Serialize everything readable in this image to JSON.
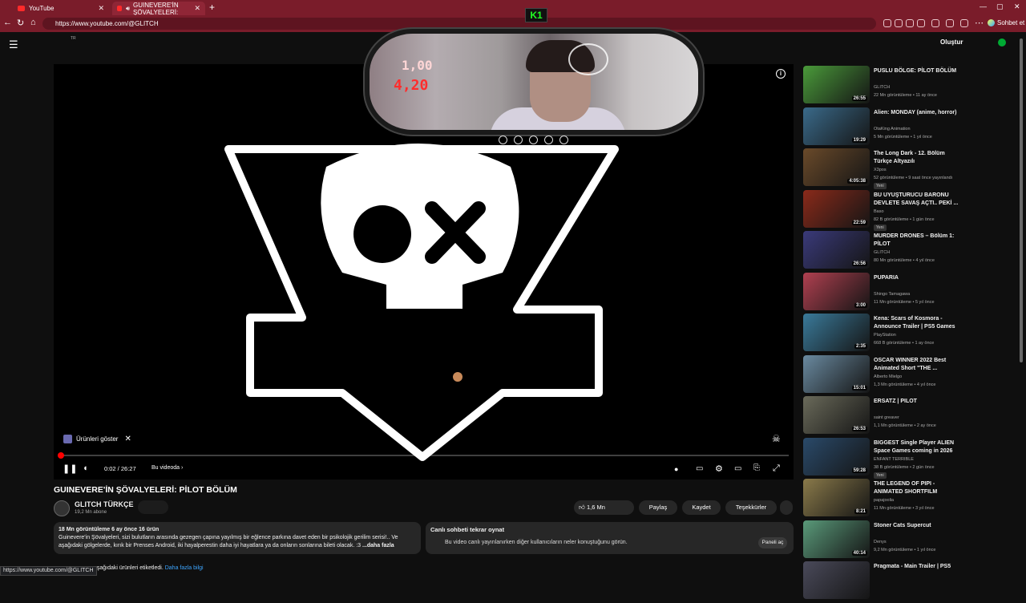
{
  "browser": {
    "tabs": [
      {
        "label": "YouTube"
      },
      {
        "label": "GUINEVERE'İN ŞÖVALYELERİ:"
      }
    ],
    "url": "https://www.youtube.com/@GLITCH",
    "chat_label": "Sohbet et",
    "status_url": "https://www.youtube.com/@GLITCH"
  },
  "header": {
    "region": "TR",
    "create_label": "Oluştur"
  },
  "stream_overlay": {
    "logo": "K1",
    "hud_top": "1,00",
    "hud_bottom": "4,20"
  },
  "player": {
    "current_time": "0:02",
    "duration": "26:27",
    "time_display": "0:02 / 26:27",
    "in_video_label": "Bu videoda",
    "products_label": "Ürünleri göster",
    "progress": 0.001
  },
  "video": {
    "title": "GUINEVERE'İN ŞÖVALYELERİ: PİLOT BÖLÜM",
    "channel": "GLITCH TÜRKÇE",
    "subscribers": "19,2 Mn abone",
    "likes": "1,6 Mn",
    "share": "Paylaş",
    "save": "Kaydet",
    "thanks": "Teşekkürler",
    "description": {
      "stats": "18 Mn görüntüleme  6 ay önce  16 ürün",
      "line1": "Guinevere'in Şövalyeleri, sizi bulutların arasında gezegen çapına yayılmış bir eğlence parkına davet eden bir psikolojik gerilim serisi!.. Ve",
      "line2": "aşağıdaki gölgelerde, kırık bir Prenses Android, iki hayalperestin daha iyi hayatlara ya da onların sonlarına bileti olacak. :3",
      "more": "...daha fazla"
    },
    "bottom_text": "aşağıdaki ürünleri etiketledi.",
    "bottom_link": "Daha fazla bilgi"
  },
  "live_chat": {
    "heading": "Canlı sohbeti tekrar oynat",
    "text": "Bu video canlı yayınlanırken diğer kullanıcıların neler konuştuğunu görün.",
    "button": "Paneli aç"
  },
  "recommendations": [
    {
      "title": "PUSLU BÖLGE: PİLOT BÖLÜM",
      "channel": "GLITCH",
      "meta": "22 Mn görüntüleme • 11 ay önce",
      "duration": "26:55",
      "badge": "",
      "color": "#4a9a3a"
    },
    {
      "title": "Alien: MONDAY (anime, horror)",
      "channel": "OtaKing Animation",
      "meta": "5 Mn görüntüleme • 1 yıl önce",
      "duration": "19:29",
      "badge": "",
      "color": "#3a6a8a"
    },
    {
      "title": "The Long Dark - 12. Bölüm Türkçe Altyazılı",
      "channel": "X3pos",
      "meta": "52 görüntüleme • 9 saat önce yayınlandı",
      "duration": "4:05:38",
      "badge": "Yeni",
      "color": "#6a4a2a"
    },
    {
      "title": "BU UYUŞTURUCU BARONU DEVLETE SAVAŞ AÇTI.. PEKİ ...",
      "channel": "Baso",
      "meta": "82 B görüntüleme • 1 gün önce",
      "duration": "22:59",
      "badge": "Yeni",
      "color": "#8a2a1a"
    },
    {
      "title": "MURDER DRONES – Bölüm 1: PİLOT",
      "channel": "GLITCH",
      "meta": "80 Mn görüntüleme • 4 yıl önce",
      "duration": "26:56",
      "badge": "",
      "color": "#3a3a7a"
    },
    {
      "title": "PUPARIA",
      "channel": "Shingo Tamagawa",
      "meta": "11 Mn görüntüleme • 5 yıl önce",
      "duration": "3:00",
      "badge": "",
      "color": "#b04050"
    },
    {
      "title": "Kena: Scars of Kosmora - Announce Trailer | PS5 Games",
      "channel": "PlayStation",
      "meta": "668 B görüntüleme • 1 ay önce",
      "duration": "2:35",
      "badge": "",
      "color": "#3a7a9a"
    },
    {
      "title": "OSCAR WINNER 2022 Best Animated Short \"THE ...",
      "channel": "Alberto Mielgo",
      "meta": "1,3 Mn görüntüleme • 4 yıl önce",
      "duration": "15:01",
      "badge": "",
      "color": "#6a8aa0"
    },
    {
      "title": "ERSATZ | PILOT",
      "channel": "saint greaver",
      "meta": "1,1 Mn görüntüleme • 2 ay önce",
      "duration": "26:53",
      "badge": "",
      "color": "#6a6a5a"
    },
    {
      "title": "BIGGEST Single Player ALIEN Space Games coming in 2026",
      "channel": "ENFANT TERRIBLE",
      "meta": "38 B görüntüleme • 2 gün önce",
      "duration": "59:28",
      "badge": "Yeni",
      "color": "#2a4a6a"
    },
    {
      "title": "THE LEGEND OF PIPI - ANIMATED SHORTFILM",
      "channel": "papajoolia",
      "meta": "11 Mn görüntüleme • 3 yıl önce",
      "duration": "8:21",
      "badge": "",
      "color": "#8a7a4a"
    },
    {
      "title": "Stoner Cats Supercut",
      "channel": "Denys",
      "meta": "9,2 Mn görüntüleme • 1 yıl önce",
      "duration": "40:14",
      "badge": "",
      "color": "#5a9a7a"
    },
    {
      "title": "Pragmata - Main Trailer | PS5",
      "channel": "",
      "meta": "",
      "duration": "",
      "badge": "",
      "color": "#4a4a5a"
    }
  ]
}
